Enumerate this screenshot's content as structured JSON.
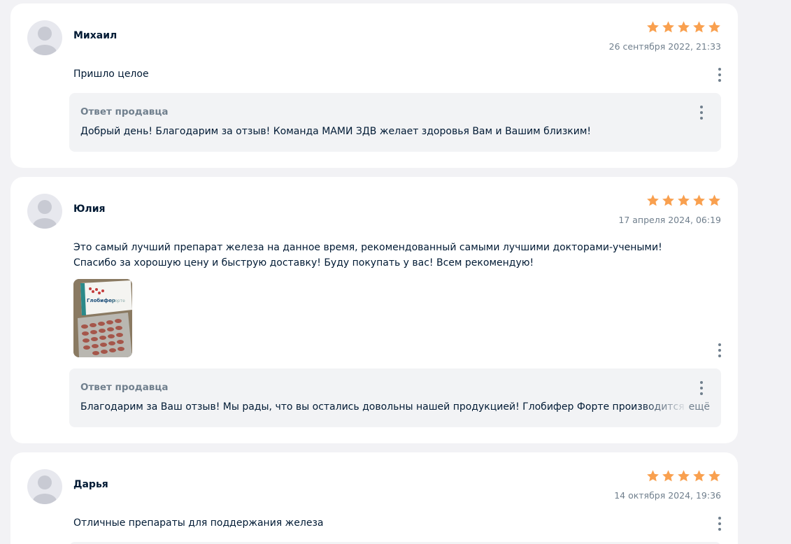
{
  "reviews": [
    {
      "author": "Михаил",
      "date": "26 сентября 2022, 21:33",
      "rating": 5,
      "text_lines": [
        "Пришло целое"
      ],
      "reply": {
        "title": "Ответ продавца",
        "text": "Добрый день! Благодарим за отзыв! Команда МАМИ ЗДВ желает здоровья Вам и Вашим близким!"
      }
    },
    {
      "author": "Юлия",
      "date": "17 апреля 2024, 06:19",
      "rating": 5,
      "text_lines": [
        "Это самый лучший препарат железа на данное время, рекомендованный самыми лучшими докторами-учеными!",
        "Спасибо за хорошую цену и быструю доставку! Буду покупать у вас! Всем рекомендую!"
      ],
      "photo": {
        "box_brand": "Глобифер",
        "box_variant": "форте"
      },
      "reply": {
        "title": "Ответ продавца",
        "text": "Благодарим за Ваш отзыв! Мы рады, что вы остались довольны нашей продукцией! Глобифер Форте производится",
        "more_label": "ещё"
      }
    },
    {
      "author": "Дарья",
      "date": "14 октября 2024, 19:36",
      "rating": 5,
      "text_lines": [
        "Отличные препараты для поддержания железа"
      ]
    }
  ],
  "colors": {
    "star": "#f9a04f",
    "page_bg": "#f2f2f5",
    "card_bg": "#ffffff",
    "reply_bg": "#f2f3f5",
    "muted": "#707f8d",
    "text": "#001a34"
  }
}
